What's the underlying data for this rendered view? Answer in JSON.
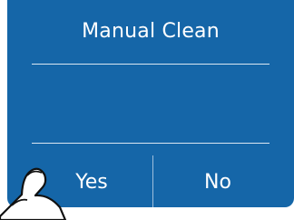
{
  "dialog": {
    "title": "Manual Clean",
    "buttons": {
      "yes_label": "Yes",
      "no_label": "No"
    }
  },
  "colors": {
    "screen_background": "#1566a8",
    "text": "#ffffff",
    "divider": "#d9e6f2"
  },
  "icons": {
    "pointer": "hand-pointer-icon"
  }
}
